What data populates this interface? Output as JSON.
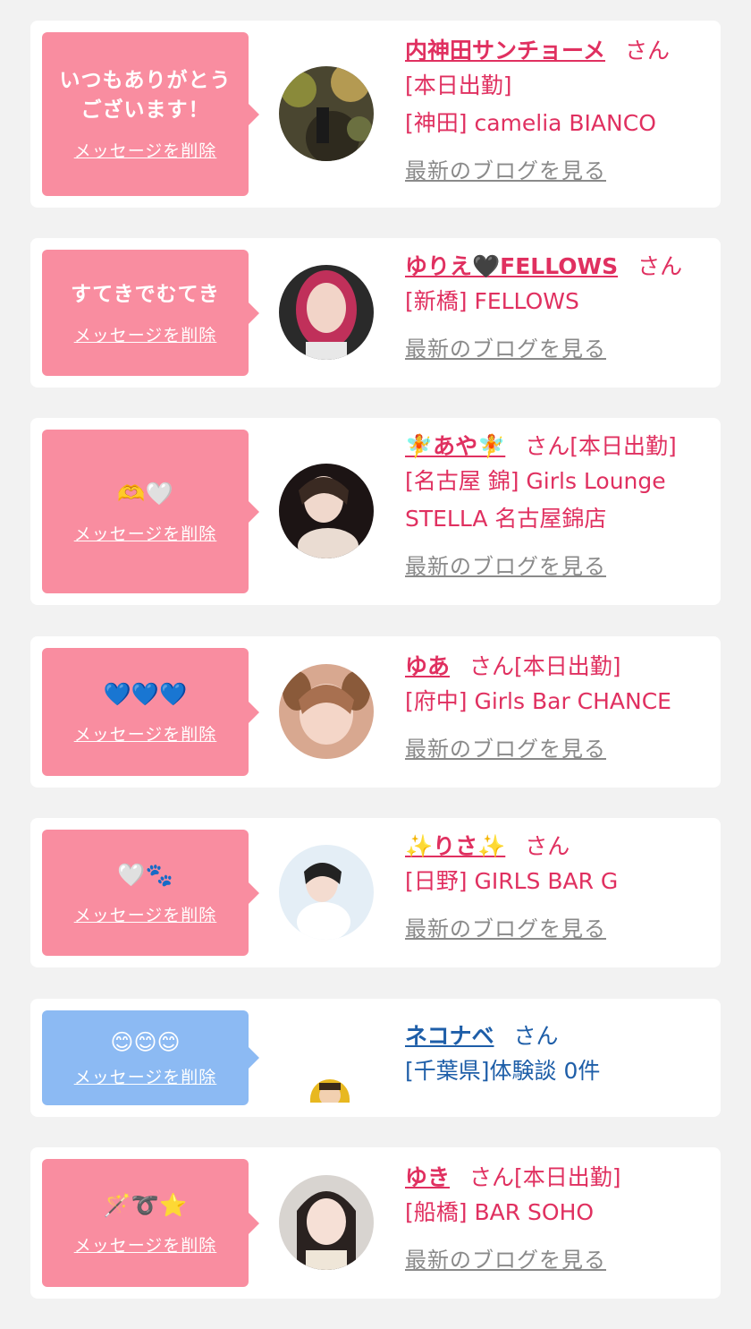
{
  "colors": {
    "pink_bubble": "#f98da0",
    "blue_bubble": "#8cbaf3",
    "name_pink": "#e03060",
    "name_blue": "#1e5ea8",
    "blog_gray": "#8a8a8a"
  },
  "cards": [
    {
      "message": "いつもありがとう\nございます！",
      "delete_label": "メッセージを削除",
      "name": "内神田サンチョーメ",
      "san": "さん",
      "lines": [
        "[本日出勤]",
        "[神田] camelia BIANCO"
      ],
      "blog_label": "最新のブログを見る"
    },
    {
      "message": "すてきでむてき",
      "delete_label": "メッセージを削除",
      "name": "ゆりえ🖤FELLOWS",
      "san": "さん",
      "lines": [
        "[新橋] FELLOWS"
      ],
      "blog_label": "最新のブログを見る"
    },
    {
      "message": "🫶🤍",
      "delete_label": "メッセージを削除",
      "name": "🧚あや🧚",
      "san": "さん[本日出勤]",
      "lines": [
        "[名古屋 錦] Girls Lounge",
        "STELLA 名古屋錦店"
      ],
      "blog_label": "最新のブログを見る"
    },
    {
      "message": "💙💙💙",
      "delete_label": "メッセージを削除",
      "name": "ゆあ",
      "san": "さん[本日出勤]",
      "lines": [
        "[府中] Girls Bar CHANCE"
      ],
      "blog_label": "最新のブログを見る"
    },
    {
      "message": "🤍🐾",
      "delete_label": "メッセージを削除",
      "name": "✨りさ✨",
      "san": "さん",
      "lines": [
        "[日野] GIRLS BAR G"
      ],
      "blog_label": "最新のブログを見る"
    },
    {
      "message": "😊😊😊",
      "delete_label": "メッセージを削除",
      "name": "ネコナベ",
      "san": "さん",
      "lines": [
        "[千葉県]体験談 0件"
      ]
    },
    {
      "message": "🪄➰⭐",
      "delete_label": "メッセージを削除",
      "name": "ゆき",
      "san": "さん[本日出勤]",
      "lines": [
        "[船橋] BAR SOHO"
      ],
      "blog_label": "最新のブログを見る"
    }
  ]
}
